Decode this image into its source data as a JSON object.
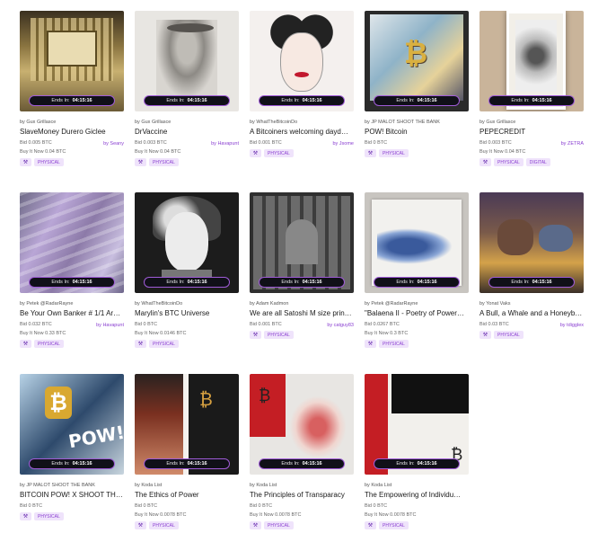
{
  "timer_label": "Ends In:",
  "timer_value": "04:15:16",
  "cards": [
    {
      "by": "by Gux Grillasce",
      "title": "SlaveMoney Durero Giclee",
      "bid": "Bid 0.005 BTC",
      "buy": "Buy It Now 0.04 BTC",
      "seller": "by Seany",
      "tags": [
        "PHYSICAL"
      ],
      "art": "gold-building"
    },
    {
      "by": "by Gux Grillasce",
      "title": "DrVaccine",
      "bid": "Bid 0.003 BTC",
      "buy": "Buy It Now 0.04 BTC",
      "seller": "by Havapunt",
      "tags": [
        "PHYSICAL"
      ],
      "art": "sketch"
    },
    {
      "by": "by WhatTheBitcoinDo",
      "title": "A Bitcoiners welcoming dayd…",
      "bid": "Bid 0.001 BTC",
      "buy": "",
      "seller": "by Jsome",
      "tags": [
        "PHYSICAL"
      ],
      "art": "pop-portrait"
    },
    {
      "by": "by JP MALOT SHOOT THE BANK",
      "title": "POW! Bitcoin",
      "bid": "Bid 0 BTC",
      "buy": "",
      "seller": "",
      "tags": [
        "PHYSICAL"
      ],
      "art": "pow-gold"
    },
    {
      "by": "by Gux Grillasce",
      "title": "PEPECREDIT",
      "bid": "Bid 0.003 BTC",
      "buy": "Buy It Now 0.04 BTC",
      "seller": "by ZETRA",
      "tags": [
        "PHYSICAL",
        "DIGITAL"
      ],
      "art": "frame"
    },
    {
      "by": "by Petek @RadarRayne",
      "title": "Be Your Own Banker # 1/1 Ar…",
      "bid": "Bid 0.032 BTC",
      "buy": "Buy It Now 0.33 BTC",
      "seller": "by Havapunt",
      "tags": [
        "PHYSICAL"
      ],
      "art": "purple-foil"
    },
    {
      "by": "by WhatTheBitcoinDo",
      "title": "Marylin's BTC Universe",
      "bid": "Bid 0 BTC",
      "buy": "Buy It Now 0.0146 BTC",
      "seller": "",
      "tags": [
        "PHYSICAL"
      ],
      "art": "bw-portrait"
    },
    {
      "by": "by Adam Kadmon",
      "title": "We are all Satoshi M size prin…",
      "bid": "Bid 0.001 BTC",
      "buy": "",
      "seller": "by catguy83",
      "tags": [
        "PHYSICAL"
      ],
      "art": "cathedral"
    },
    {
      "by": "by Petek @RadarRayne",
      "title": "\"Balaena II - Poetry of Power…",
      "bid": "Bid 0.0267 BTC",
      "buy": "Buy It Now 0.3 BTC",
      "seller": "",
      "tags": [
        "PHYSICAL"
      ],
      "art": "whale"
    },
    {
      "by": "by Yonat Vaks",
      "title": "A Bull, a Whale and a Honeyb…",
      "bid": "Bid 0.03 BTC",
      "buy": "",
      "seller": "by tdigglex",
      "tags": [
        "PHYSICAL"
      ],
      "art": "bull"
    },
    {
      "by": "by JP MALOT SHOOT THE BANK",
      "title": "BITCOIN POW! X SHOOT TH…",
      "bid": "Bid 0 BTC",
      "buy": "",
      "seller": "",
      "tags": [
        "PHYSICAL"
      ],
      "art": "pow-blue"
    },
    {
      "by": "by Koda List",
      "title": "The Ethics of Power",
      "bid": "Bid 0 BTC",
      "buy": "Buy It Now 0.0078 BTC",
      "seller": "",
      "tags": [
        "PHYSICAL"
      ],
      "art": "ethics"
    },
    {
      "by": "by Koda List",
      "title": "The Principles of Transparacy",
      "bid": "Bid 0 BTC",
      "buy": "Buy It Now 0.0078 BTC",
      "seller": "",
      "tags": [
        "PHYSICAL"
      ],
      "art": "principles"
    },
    {
      "by": "by Koda List",
      "title": "The Empowering of Individu…",
      "bid": "Bid 0 BTC",
      "buy": "Buy It Now 0.0078 BTC",
      "seller": "",
      "tags": [
        "PHYSICAL"
      ],
      "art": "empowering"
    }
  ]
}
